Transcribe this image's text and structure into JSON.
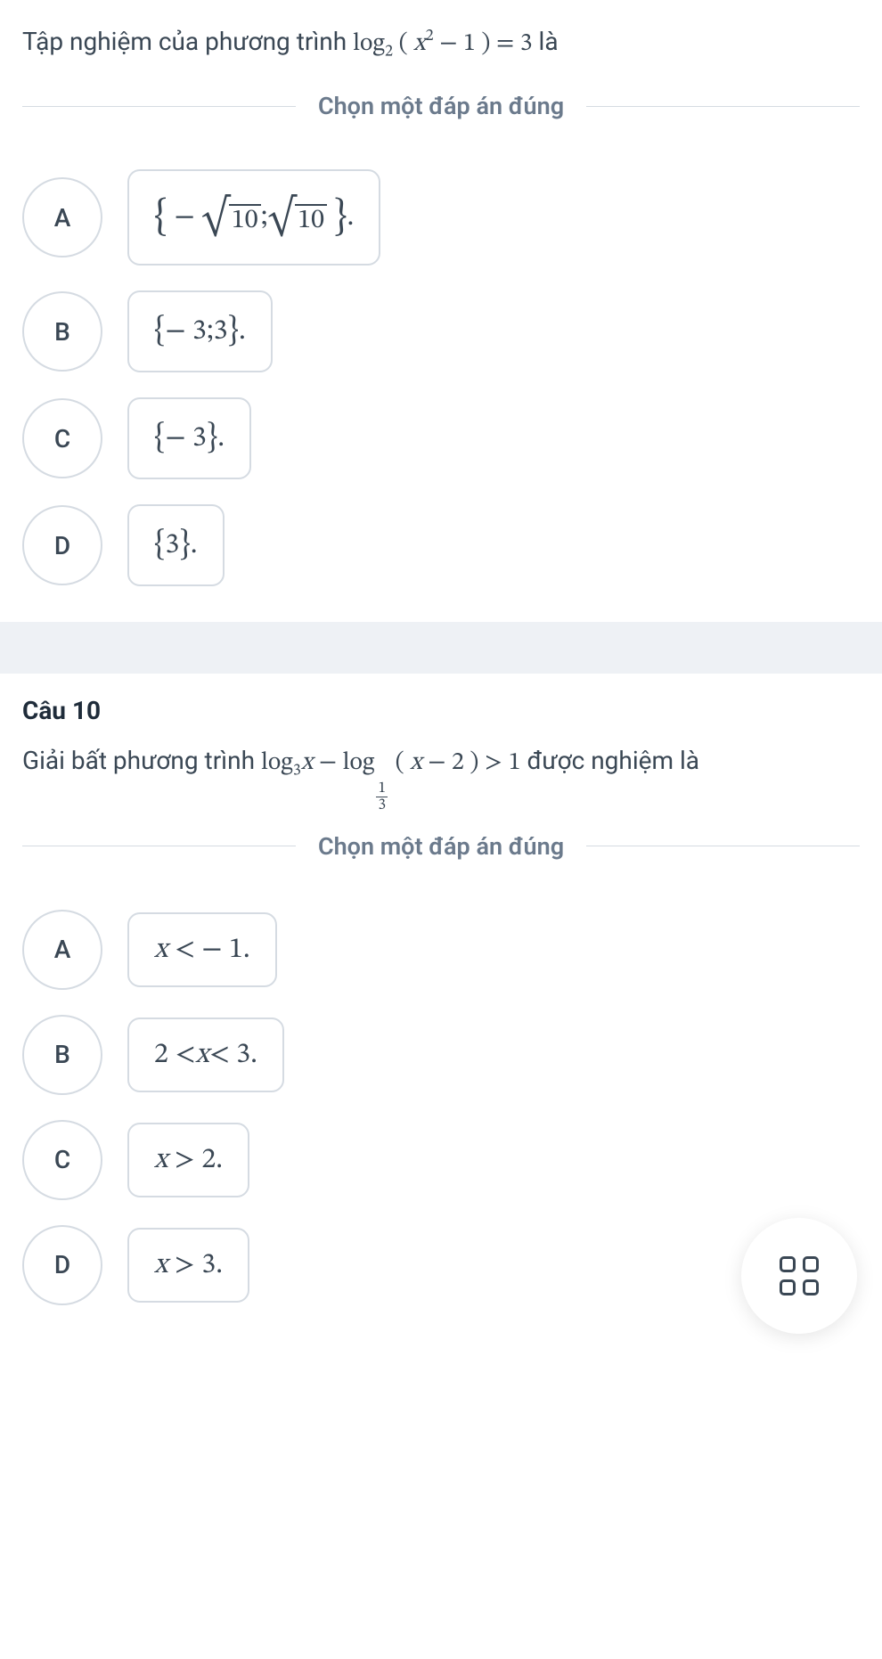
{
  "q1": {
    "prompt_prefix": "Tập nghiệm của phương trình ",
    "prompt_math": "log₂ (x² − 1) = 3",
    "prompt_suffix": " là",
    "divider": "Chọn một đáp án đúng",
    "options": {
      "A": {
        "letter": "A",
        "math": "{ −√10 ; √10 } ."
      },
      "B": {
        "letter": "B",
        "math": "{ − 3 ; 3 } ."
      },
      "C": {
        "letter": "C",
        "math": "{ − 3 } ."
      },
      "D": {
        "letter": "D",
        "math": "{ 3 } ."
      }
    }
  },
  "q2": {
    "title": "Câu 10",
    "prompt_prefix": "Giải bất phương trình ",
    "prompt_math": "log₃x − log_{1/3} (x − 2) > 1",
    "prompt_suffix": " được nghiệm là",
    "divider": "Chọn một đáp án đúng",
    "options": {
      "A": {
        "letter": "A",
        "math": "x < − 1."
      },
      "B": {
        "letter": "B",
        "math": "2 < x < 3."
      },
      "C": {
        "letter": "C",
        "math": "x > 2."
      },
      "D": {
        "letter": "D",
        "math": "x > 3."
      }
    }
  },
  "math_tokens": {
    "log": "log",
    "ten": "10",
    "three": "3",
    "minus_three": " − 3 ",
    "three_spaced": " 3 ",
    "x_lt_neg1": "x < − 1.",
    "two_lt_x_lt_3": "2 < x < 3.",
    "x_gt_2": "x > 2.",
    "x_gt_3": "x > 3.",
    "dot": " .",
    "semicolon": " ; "
  }
}
